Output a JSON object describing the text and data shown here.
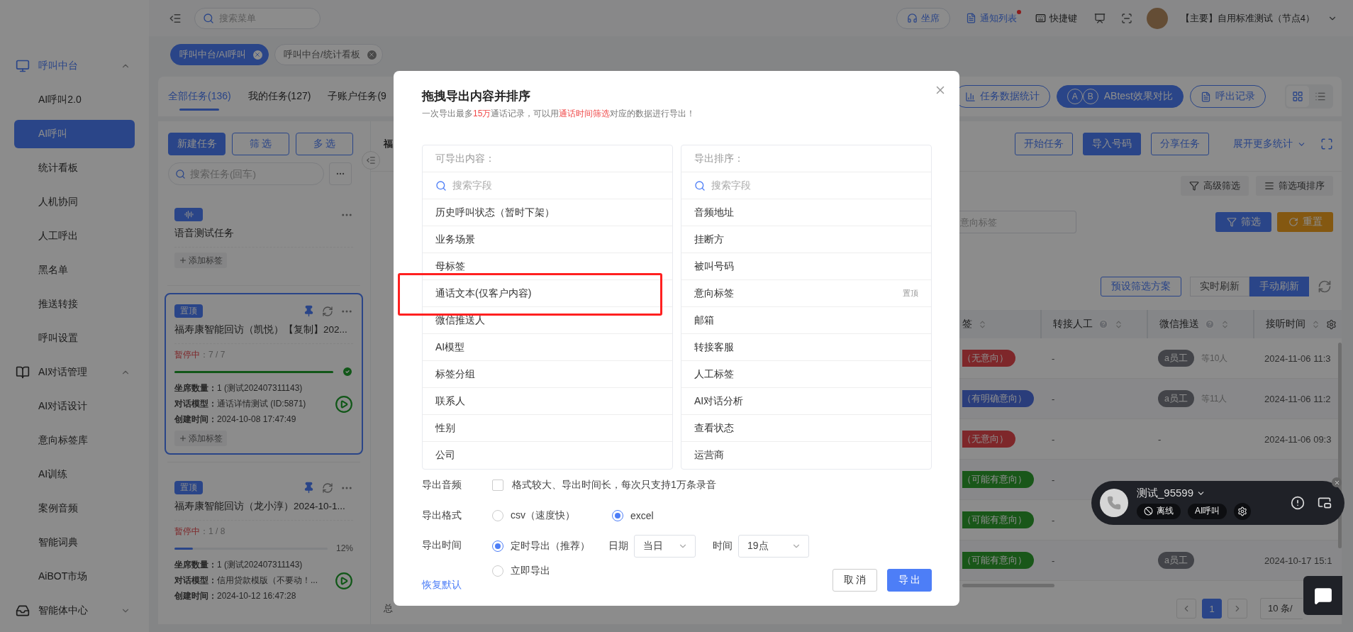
{
  "sidebar": {
    "groups": [
      {
        "label": "呼叫中台",
        "expanded": true,
        "active": true,
        "items": [
          {
            "label": "AI呼叫2.0",
            "selected": false
          },
          {
            "label": "AI呼叫",
            "selected": true
          },
          {
            "label": "统计看板",
            "selected": false
          },
          {
            "label": "人机协同",
            "selected": false
          },
          {
            "label": "人工呼出",
            "selected": false
          },
          {
            "label": "黑名单",
            "selected": false
          },
          {
            "label": "推送转接",
            "selected": false
          },
          {
            "label": "呼叫设置",
            "selected": false
          }
        ]
      },
      {
        "label": "AI对话管理",
        "expanded": true,
        "active": false,
        "items": [
          {
            "label": "AI对话设计",
            "selected": false
          },
          {
            "label": "意向标签库",
            "selected": false
          },
          {
            "label": "AI训练",
            "selected": false
          },
          {
            "label": "案例音频",
            "selected": false
          },
          {
            "label": "智能词典",
            "selected": false
          },
          {
            "label": "AiBOT市场",
            "selected": false
          }
        ]
      },
      {
        "label": "智能体中心",
        "expanded": false,
        "active": false
      }
    ]
  },
  "topbar": {
    "search": {
      "placeholder": "搜索菜单"
    },
    "seat_button": "坐席",
    "notifications": {
      "label": "通知列表",
      "unread": true
    },
    "shortcuts": "快捷键",
    "account": "【主要】自用标准测试（节点4）"
  },
  "page_tabs": [
    {
      "label": "呼叫中台/AI呼叫",
      "selected": true
    },
    {
      "label": "呼叫中台/统计看板",
      "selected": false
    }
  ],
  "task_tabs": [
    {
      "label": "全部任务(136)",
      "selected": true
    },
    {
      "label": "我的任务(127)",
      "selected": false
    },
    {
      "label": "子账户任务(9",
      "selected": false
    }
  ],
  "header_tools": [
    {
      "label": "任务数据统计",
      "kind": "stats",
      "primary": false
    },
    {
      "label": "ABtest效果对比",
      "kind": "compare",
      "badges": [
        "A",
        "B"
      ],
      "primary": true
    },
    {
      "label": "呼出记录",
      "kind": "records",
      "primary": false
    }
  ],
  "view_modes": [
    {
      "kind": "grid",
      "selected": true
    },
    {
      "kind": "list",
      "selected": false
    }
  ],
  "task_panel": {
    "buttons": [
      {
        "label": "新建任务",
        "primary": true
      },
      {
        "label": "筛 选",
        "primary": false
      },
      {
        "label": "多 选",
        "primary": false
      }
    ],
    "search": {
      "placeholder": "搜索任务(回车)"
    },
    "tasks": [
      {
        "kind": "voice",
        "title": "语音测试任务",
        "selected": false,
        "tag_button": "添加标签"
      },
      {
        "kind": "task",
        "badge": "置顶",
        "title": "福寿康智能回访（凯悦）【复制】202...",
        "selected": true,
        "status": "暂停中",
        "progress": "：7 / 7",
        "level": 1,
        "complete": true,
        "fields": [
          {
            "label": "坐席数量：",
            "value": "1 (测试202407311143)"
          },
          {
            "label": "对话模型：",
            "value": "通话详情测试 (ID:5871)"
          },
          {
            "label": "创建时间：",
            "value": "2024-10-08 17:47:49"
          }
        ],
        "tag_button": "添加标签"
      },
      {
        "kind": "task",
        "badge": "置顶",
        "title": "福寿康智能回访（龙小淳）2024-10-1...",
        "selected": false,
        "status": "暂停中",
        "progress": "：1 / 8",
        "level": 0.12,
        "complete": false,
        "percent": "12%",
        "fields": [
          {
            "label": "坐席数量：",
            "value": "1 (测试202407311143)"
          },
          {
            "label": "对话模型：",
            "value": "信用贷款模版（不要动！..."
          },
          {
            "label": "创建时间：",
            "value": "2024-10-12 16:47:28"
          }
        ]
      }
    ]
  },
  "detail": {
    "title": "福",
    "actions": [
      {
        "label": "开始任务",
        "primary": false
      },
      {
        "label": "导入号码",
        "primary": true
      },
      {
        "label": "分享任务",
        "primary": false
      }
    ],
    "more_stats": "展开更多统计",
    "filter_tools": [
      {
        "label": "高级筛选",
        "kind": "filter"
      },
      {
        "label": "筛选项排序",
        "kind": "sort"
      }
    ],
    "filter_field": {
      "placeholder": "意向标签"
    },
    "filter_buttons": [
      {
        "label": "筛选",
        "kind": "filter"
      },
      {
        "label": "重置",
        "kind": "reset"
      }
    ],
    "preset_button": "预设筛选方案",
    "refresh_modes": [
      {
        "label": "实时刷新",
        "selected": false
      },
      {
        "label": "手动刷新",
        "selected": true
      }
    ],
    "table": {
      "columns": [
        {
          "label": "签",
          "help": false
        },
        {
          "label": "转接人工",
          "help": true
        },
        {
          "label": "微信推送",
          "help": true
        },
        {
          "label": "接听时间",
          "help": false
        }
      ],
      "rows": [
        {
          "intent": {
            "label": "（无意向）",
            "kind": "none"
          },
          "transfer": "-",
          "wechat": {
            "kind": "staff",
            "staff": "a员工",
            "more": "等10人"
          },
          "time": "2024-11-06 11:3"
        },
        {
          "intent": {
            "label": "（有明确意向）",
            "kind": "clear"
          },
          "transfer": "-",
          "wechat": {
            "kind": "staff",
            "staff": "a员工",
            "more": "等11人"
          },
          "time": "2024-11-06 11:2"
        },
        {
          "intent": {
            "label": "（无意向）",
            "kind": "none"
          },
          "transfer": "-",
          "wechat": {
            "kind": "none",
            "text": "-"
          },
          "time": "2024-11-06 09:3"
        },
        {
          "intent": {
            "label": "（可能有意向）",
            "kind": "possible"
          },
          "transfer": "-"
        },
        {
          "intent": {
            "label": "（可能有意向）",
            "kind": "possible"
          },
          "transfer": "-"
        },
        {
          "intent": {
            "label": "（可能有意向）",
            "kind": "possible"
          },
          "transfer": "-",
          "wechat": {
            "kind": "staff",
            "staff": "a员工"
          },
          "time": "2024-10-17 15:1"
        }
      ]
    },
    "total": "总",
    "pages": [
      {
        "label": "1",
        "selected": true
      }
    ],
    "page_size": "10 条/"
  },
  "export_dialog": {
    "title": "拖拽导出内容并排序",
    "subtitle": [
      {
        "text": "一次导出最多",
        "highlight": false
      },
      {
        "text": "15万",
        "highlight": true
      },
      {
        "text": "通话记录，可以用",
        "highlight": false
      },
      {
        "text": "通话时间筛选",
        "highlight": true
      },
      {
        "text": "对应的数据进行导出！",
        "highlight": false
      }
    ],
    "available": {
      "header": "可导出内容：",
      "search": {
        "placeholder": "搜索字段"
      },
      "items": [
        {
          "label": "历史呼叫状态（暂时下架）",
          "marked": false
        },
        {
          "label": "业务场景",
          "marked": false
        },
        {
          "label": "母标签",
          "marked": false
        },
        {
          "label": "通话文本(仅客户内容)",
          "marked": true
        },
        {
          "label": "微信推送人",
          "marked": false
        },
        {
          "label": "AI模型",
          "marked": false
        },
        {
          "label": "标签分组",
          "marked": false
        },
        {
          "label": "联系人",
          "marked": false
        },
        {
          "label": "性别",
          "marked": false
        },
        {
          "label": "公司",
          "marked": false
        }
      ]
    },
    "order": {
      "header": "导出排序：",
      "search": {
        "placeholder": "搜索字段"
      },
      "items": [
        {
          "label": "音频地址"
        },
        {
          "label": "挂断方"
        },
        {
          "label": "被叫号码"
        },
        {
          "label": "意向标签",
          "action": "置顶"
        },
        {
          "label": "邮箱"
        },
        {
          "label": "转接客服"
        },
        {
          "label": "人工标签"
        },
        {
          "label": "AI对话分析"
        },
        {
          "label": "查看状态"
        },
        {
          "label": "运营商"
        }
      ]
    },
    "audio": {
      "label": "导出音频",
      "checked": false,
      "hint": "格式较大、导出时间长，每次只支持1万条录音"
    },
    "format": {
      "label": "导出格式",
      "options": [
        {
          "label": "csv（速度快）",
          "selected": false
        },
        {
          "label": "excel",
          "selected": true
        }
      ]
    },
    "time": {
      "label": "导出时间",
      "options": [
        {
          "label": "定时导出（推荐）",
          "selected": true
        },
        {
          "label": "立即导出",
          "selected": false
        }
      ],
      "date": {
        "label": "日期",
        "value": "当日"
      },
      "hour": {
        "label": "时间",
        "value": "19点"
      }
    },
    "reset_link": "恢复默认",
    "buttons": [
      {
        "label": "取 消",
        "primary": false
      },
      {
        "label": "导 出",
        "primary": true
      }
    ]
  },
  "call_widget": {
    "name": "测试_95599",
    "status": "离线",
    "mode": "AI呼叫"
  }
}
